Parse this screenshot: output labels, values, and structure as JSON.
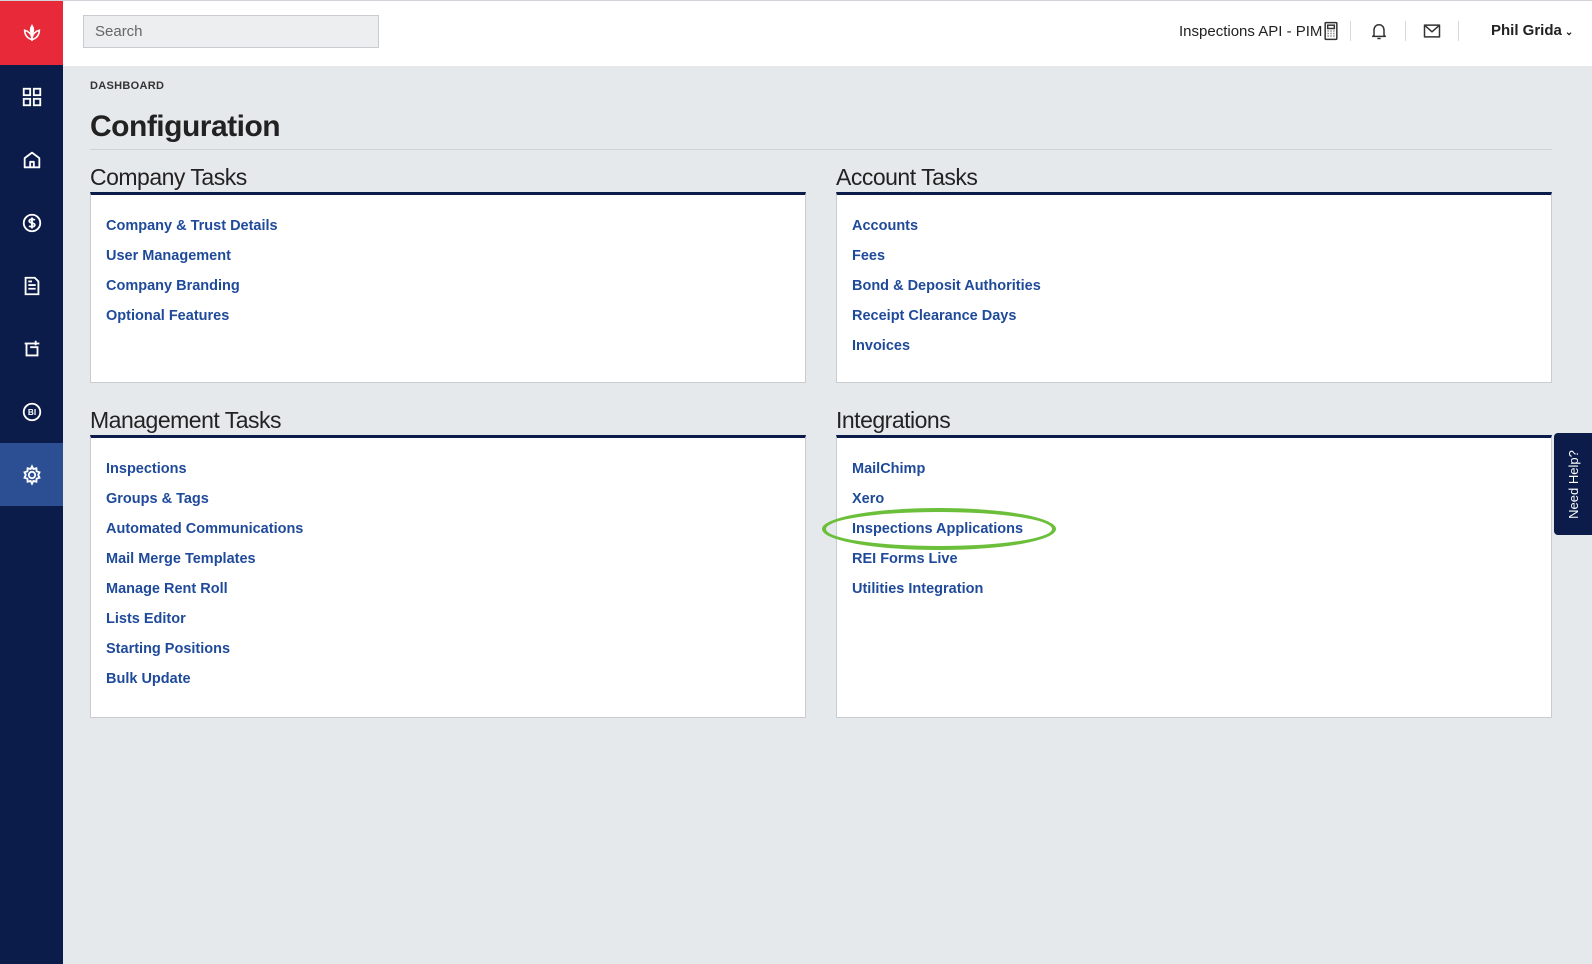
{
  "search": {
    "placeholder": "Search"
  },
  "header": {
    "tenant": "Inspections API - PIM",
    "user": "Phil Grida"
  },
  "breadcrumb": "DASHBOARD",
  "page_title": "Configuration",
  "panels": {
    "company": {
      "title": "Company Tasks",
      "links": [
        "Company & Trust Details",
        "User Management",
        "Company Branding",
        "Optional Features"
      ]
    },
    "account": {
      "title": "Account Tasks",
      "links": [
        "Accounts",
        "Fees",
        "Bond & Deposit Authorities",
        "Receipt Clearance Days",
        "Invoices"
      ]
    },
    "management": {
      "title": "Management Tasks",
      "links": [
        "Inspections",
        "Groups & Tags",
        "Automated Communications",
        "Mail Merge Templates",
        "Manage Rent Roll",
        "Lists Editor",
        "Starting Positions",
        "Bulk Update"
      ]
    },
    "integrations": {
      "title": "Integrations",
      "links": [
        "MailChimp",
        "Xero",
        "Inspections Applications",
        "REI Forms Live",
        "Utilities Integration"
      ]
    }
  },
  "help_tab": "Need Help?",
  "sidebar_icons": [
    "dashboard-icon",
    "home-icon",
    "dollar-icon",
    "document-icon",
    "calendar-icon",
    "bi-icon",
    "settings-icon"
  ],
  "colors": {
    "sidebar": "#0c1c4a",
    "logo": "#e8293a",
    "active": "#2c4f94",
    "link": "#1f4a9a",
    "highlight": "#6cbf3a"
  }
}
